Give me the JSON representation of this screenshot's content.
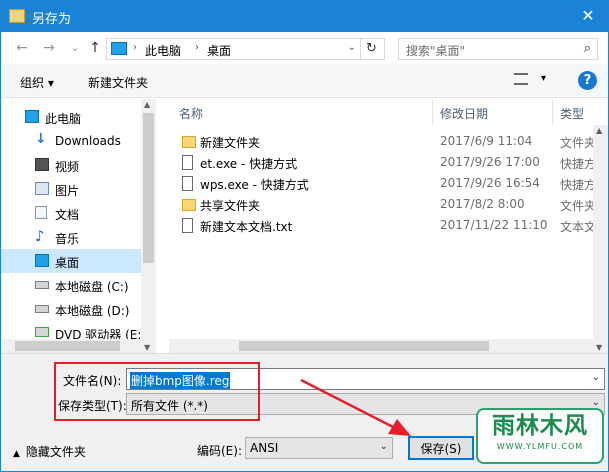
{
  "window": {
    "title": "另存为",
    "close_glyph": "✕"
  },
  "nav_buttons": {
    "back": "←",
    "forward": "→",
    "recent": "⌄",
    "up": "↑"
  },
  "address": {
    "segments": [
      "此电脑",
      "桌面"
    ],
    "separator": "›",
    "dropdown": "⌄",
    "refresh": "↻"
  },
  "search": {
    "placeholder": "搜索\"桌面\"",
    "icon": "search-icon",
    "glyph": "⌕"
  },
  "toolbar": {
    "organize_label": "组织 ▾",
    "new_folder_label": "新建文件夹",
    "view_dd": "▾",
    "help_label": "?"
  },
  "nav": {
    "items": [
      {
        "label": "此电脑",
        "icon": "computer-icon",
        "color": "#1da1e8"
      },
      {
        "label": "Downloads",
        "icon": "download-icon",
        "color": "#2b7cd3"
      },
      {
        "label": "视频",
        "icon": "video-icon",
        "color": "#555555"
      },
      {
        "label": "图片",
        "icon": "pictures-icon",
        "color": "#6a8cb8"
      },
      {
        "label": "文档",
        "icon": "documents-icon",
        "color": "#8a9bb0"
      },
      {
        "label": "音乐",
        "icon": "music-icon",
        "color": "#1b74c9"
      },
      {
        "label": "桌面",
        "icon": "desktop-icon",
        "color": "#1da1e8"
      },
      {
        "label": "本地磁盘 (C:)",
        "icon": "drive-icon",
        "color": "#7d7d7d"
      },
      {
        "label": "本地磁盘 (D:)",
        "icon": "drive-icon",
        "color": "#7d7d7d"
      },
      {
        "label": "DVD 驱动器 (E:)",
        "icon": "dvd-icon",
        "color": "#3aa845"
      }
    ],
    "selected": "桌面",
    "scroll_up": "▲",
    "scroll_down": "▼"
  },
  "files": {
    "columns": [
      "名称",
      "修改日期",
      "类型"
    ],
    "rows": [
      {
        "name": "新建文件夹",
        "date": "2017/6/9 11:04",
        "type": "文件夹",
        "icon": "folder-icon"
      },
      {
        "name": "et.exe - 快捷方式",
        "date": "2017/9/26 17:00",
        "type": "快捷方式",
        "icon": "shortcut-icon"
      },
      {
        "name": "wps.exe - 快捷方式",
        "date": "2017/9/26 16:54",
        "type": "快捷方式",
        "icon": "shortcut-icon"
      },
      {
        "name": "共享文件夹",
        "date": "2017/8/2 8:00",
        "type": "文件夹",
        "icon": "folder-icon"
      },
      {
        "name": "新建文本文档.txt",
        "date": "2017/11/22 11:10",
        "type": "文本文档",
        "icon": "text-file-icon"
      }
    ],
    "scroll_up": "▲",
    "scroll_down": "▼"
  },
  "form": {
    "filename_label": "文件名(N):",
    "filename_value": "删掉bmp图像.reg",
    "savetype_label": "保存类型(T):",
    "savetype_value": "所有文件  (*.*)",
    "dropdown": "⌄",
    "hide_folders_label": "隐藏文件夹",
    "hide_caret": "▲",
    "encoding_label": "编码(E):",
    "encoding_value": "ANSI",
    "save_button": "保存(S)"
  },
  "annotation_colors": {
    "highlight_box": "#e4202a",
    "arrow": "#e4202a"
  },
  "watermark": {
    "line1": "雨林木风",
    "line2": "WWW.YLMFU.COM"
  }
}
